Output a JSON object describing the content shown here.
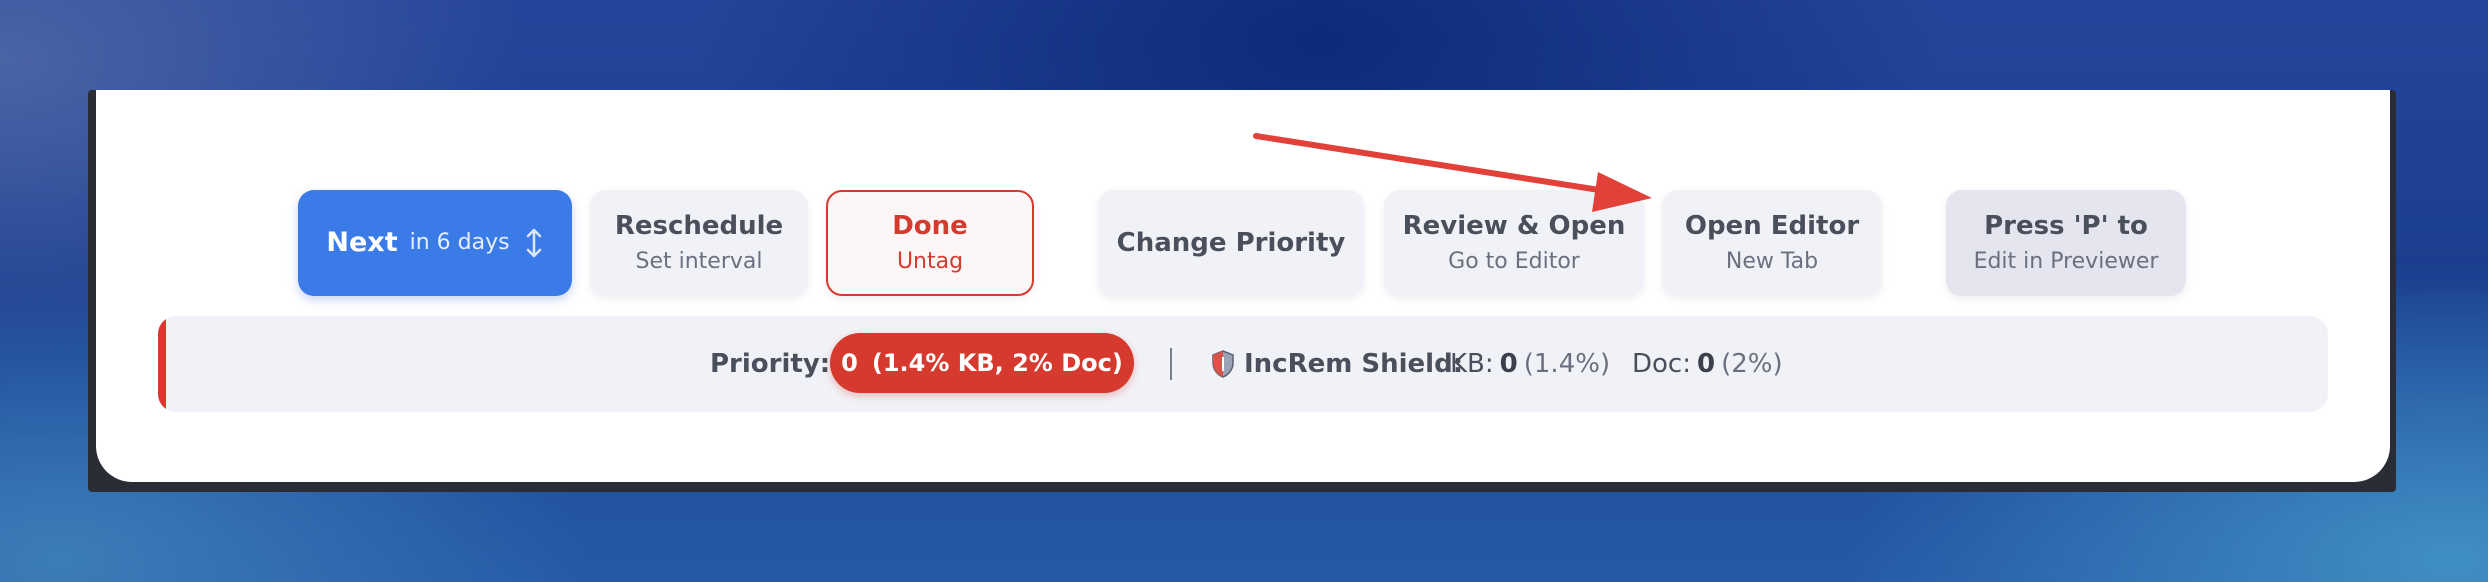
{
  "actions": {
    "next": {
      "label": "Next",
      "sub": "in 6 days"
    },
    "reschedule": {
      "label": "Reschedule",
      "sub": "Set interval"
    },
    "done": {
      "label": "Done",
      "sub": "Untag"
    },
    "change_priority": {
      "label": "Change Priority"
    },
    "review_open": {
      "label": "Review & Open",
      "sub": "Go to Editor"
    },
    "open_editor": {
      "label": "Open Editor",
      "sub": "New Tab"
    },
    "press_p": {
      "label": "Press 'P' to",
      "sub": "Edit in Previewer"
    }
  },
  "info_bar": {
    "priority_label": "Priority:",
    "priority_value": "0",
    "priority_detail": "(1.4% KB, 2% Doc)",
    "shield_label": "IncRem Shield:",
    "kb_label": "KB:",
    "kb_value": "0",
    "kb_pct": "(1.4%)",
    "doc_label": "Doc:",
    "doc_value": "0",
    "doc_pct": "(2%)"
  },
  "icons": {
    "updown": "up-down-arrow-icon",
    "shield": "shield-icon",
    "annotation": "annotation-arrow"
  },
  "colors": {
    "primary": "#3b7be8",
    "danger": "#d63a2e",
    "surface": "#f1f2f7"
  }
}
